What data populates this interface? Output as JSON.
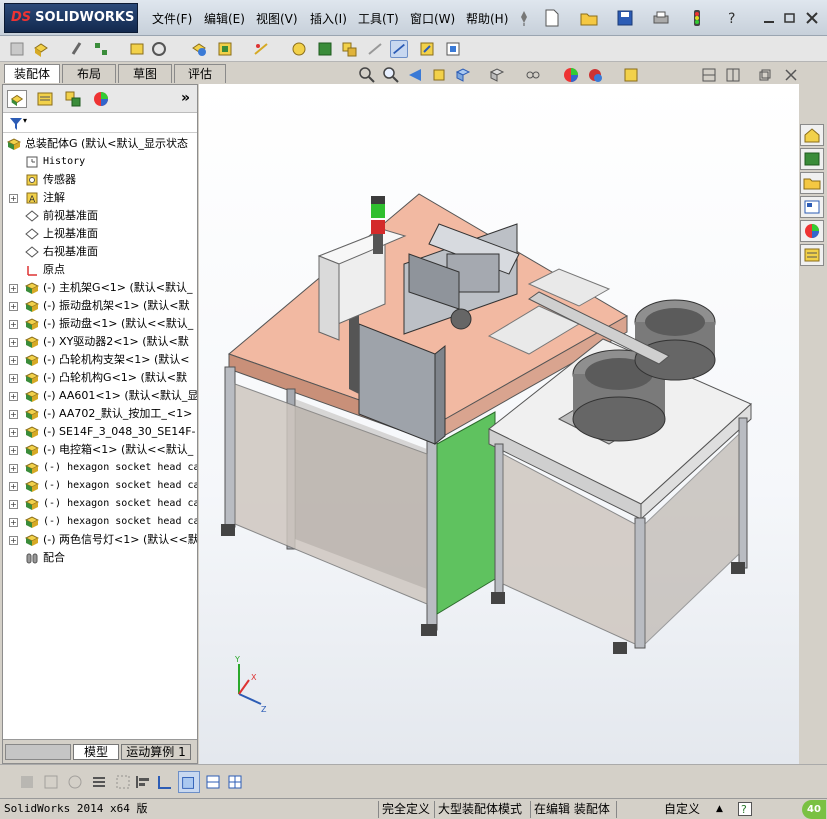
{
  "app": {
    "logo_brand": "DS",
    "logo_text": "SOLIDWORKS"
  },
  "menu": [
    {
      "label": "文件(F)"
    },
    {
      "label": "编辑(E)"
    },
    {
      "label": "视图(V)"
    },
    {
      "label": "插入(I)"
    },
    {
      "label": "工具(T)"
    },
    {
      "label": "窗口(W)"
    },
    {
      "label": "帮助(H)"
    }
  ],
  "command_tabs": [
    {
      "label": "装配体",
      "active": true
    },
    {
      "label": "布局",
      "active": false
    },
    {
      "label": "草图",
      "active": false
    },
    {
      "label": "评估",
      "active": false
    }
  ],
  "feature_tree": {
    "panel_more": "»",
    "root": "总装配体G  (默认<默认_显示状态",
    "nodes": [
      {
        "label": "History",
        "mono": true,
        "expander": false,
        "icon": "history-icon"
      },
      {
        "label": "传感器",
        "mono": false,
        "expander": false,
        "icon": "sensor-icon"
      },
      {
        "label": "注解",
        "mono": false,
        "expander": true,
        "icon": "annotation-icon"
      },
      {
        "label": "前视基准面",
        "mono": false,
        "expander": false,
        "icon": "plane-icon"
      },
      {
        "label": "上视基准面",
        "mono": false,
        "expander": false,
        "icon": "plane-icon"
      },
      {
        "label": "右视基准面",
        "mono": false,
        "expander": false,
        "icon": "plane-icon"
      },
      {
        "label": "原点",
        "mono": false,
        "expander": false,
        "icon": "origin-icon"
      },
      {
        "label": "(-) 主机架G<1> (默认<默认_",
        "mono": false,
        "expander": true,
        "icon": "part-icon"
      },
      {
        "label": "(-) 振动盘机架<1> (默认<默",
        "mono": false,
        "expander": true,
        "icon": "part-icon"
      },
      {
        "label": "(-) 振动盘<1> (默认<<默认_",
        "mono": false,
        "expander": true,
        "icon": "part-icon"
      },
      {
        "label": "(-) XY驱动器2<1> (默认<默",
        "mono": false,
        "expander": true,
        "icon": "part-icon"
      },
      {
        "label": "(-) 凸轮机构支架<1> (默认<",
        "mono": false,
        "expander": true,
        "icon": "part-icon"
      },
      {
        "label": "(-) 凸轮机构G<1> (默认<默",
        "mono": false,
        "expander": true,
        "icon": "part-icon"
      },
      {
        "label": "(-) AA601<1> (默认<默认_显",
        "mono": false,
        "expander": true,
        "icon": "part-icon"
      },
      {
        "label": "(-) AA702_默认_按加工_<1>",
        "mono": false,
        "expander": true,
        "icon": "part-icon"
      },
      {
        "label": "(-) SE14F_3_048_30_SE14F-",
        "mono": false,
        "expander": true,
        "icon": "part-icon"
      },
      {
        "label": "(-) 电控箱<1> (默认<<默认_",
        "mono": false,
        "expander": true,
        "icon": "part-icon"
      },
      {
        "label": "(-) hexagon socket head ca",
        "mono": true,
        "expander": true,
        "icon": "part-icon"
      },
      {
        "label": "(-) hexagon socket head ca",
        "mono": true,
        "expander": true,
        "icon": "part-icon"
      },
      {
        "label": "(-) hexagon socket head ca",
        "mono": true,
        "expander": true,
        "icon": "part-icon"
      },
      {
        "label": "(-) hexagon socket head ca",
        "mono": true,
        "expander": true,
        "icon": "part-icon"
      },
      {
        "label": "(-) 两色信号灯<1> (默认<<默",
        "mono": false,
        "expander": true,
        "icon": "part-icon"
      },
      {
        "label": "配合",
        "mono": false,
        "expander": false,
        "icon": "mates-icon"
      }
    ]
  },
  "bottom_tabs": [
    {
      "label": "模型"
    },
    {
      "label": "运动算例 1"
    }
  ],
  "status": {
    "version": "SolidWorks 2014 x64 版",
    "definition": "完全定义",
    "mode": "大型装配体模式",
    "editing": "在编辑 装配体",
    "custom": "自定义",
    "badge": "40"
  },
  "colors": {
    "accent": "#13294e",
    "table_top": "#f2b9a2",
    "frame": "#b9bcc2",
    "green_panel": "#5fc25f"
  }
}
